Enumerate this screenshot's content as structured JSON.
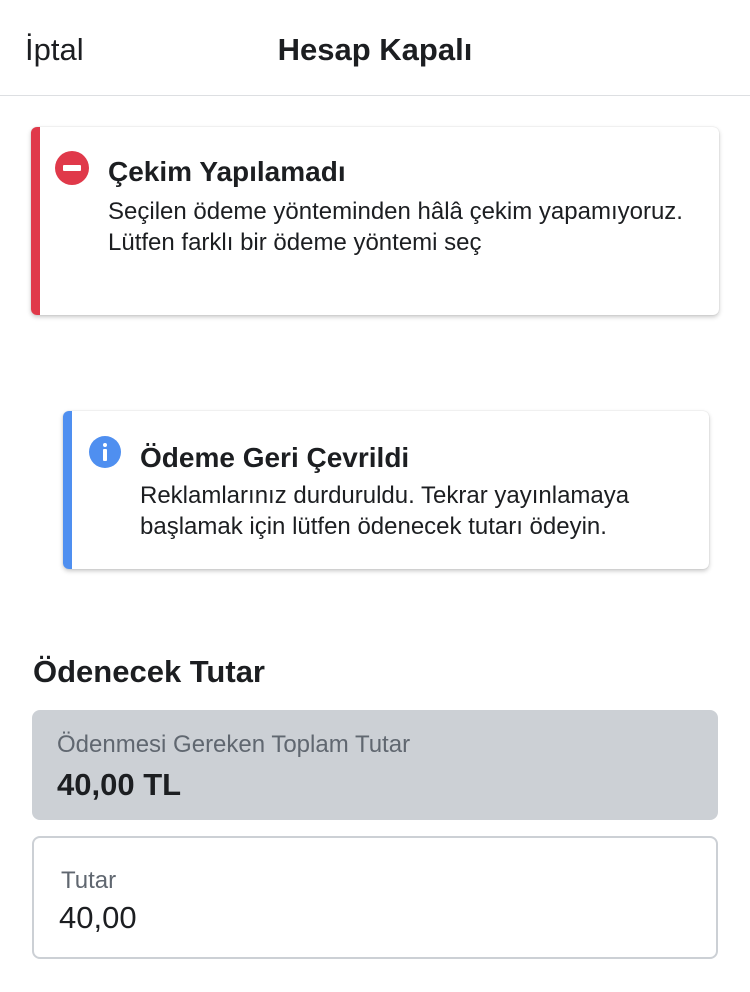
{
  "header": {
    "cancel_label": "İptal",
    "title": "Hesap Kapalı"
  },
  "alerts": {
    "error": {
      "icon": "no-entry-icon",
      "color": "#e0394a",
      "title": "Çekim Yapılamadı",
      "message": "Seçilen ödeme yönteminden hâlâ çekim yapamıyoruz. Lütfen farklı bir ödeme yöntemi seç"
    },
    "info": {
      "icon": "info-icon",
      "color": "#4f8ff0",
      "title": "Ödeme Geri Çevrildi",
      "message": "Reklamlarınız durduruldu. Tekrar yayınlamaya başlamak için lütfen ödenecek tutarı ödeyin."
    }
  },
  "payment": {
    "section_title": "Ödenecek Tutar",
    "total_label": "Ödenmesi Gereken Toplam Tutar",
    "total_value": "40,00 TL",
    "amount_label": "Tutar",
    "amount_value": "40,00"
  }
}
